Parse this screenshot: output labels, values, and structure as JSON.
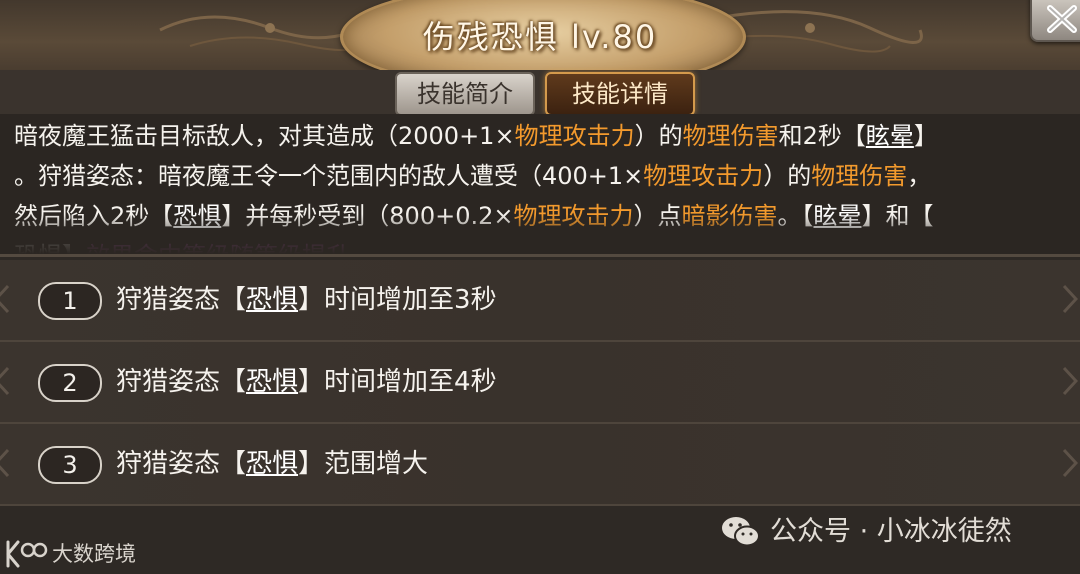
{
  "header": {
    "title": "伤残恐惧 lv.80"
  },
  "tabs": [
    {
      "label": "技能简介",
      "active": false
    },
    {
      "label": "技能详情",
      "active": true
    }
  ],
  "description": {
    "lines": [
      [
        {
          "t": "暗夜魔王猛击目标敌人，对其造成（2000+1×",
          "style": "normal"
        },
        {
          "t": "物理攻击力",
          "style": "orange"
        },
        {
          "t": "）的",
          "style": "normal"
        },
        {
          "t": "物理伤害",
          "style": "orange"
        },
        {
          "t": "和2秒【",
          "style": "normal"
        },
        {
          "t": "眩晕",
          "style": "keyword"
        },
        {
          "t": "】",
          "style": "normal"
        }
      ],
      [
        {
          "t": "。狩猎姿态：暗夜魔王令一个范围内的敌人遭受（400+1×",
          "style": "normal"
        },
        {
          "t": "物理攻击力",
          "style": "orange"
        },
        {
          "t": "）的",
          "style": "normal"
        },
        {
          "t": "物理伤害",
          "style": "orange"
        },
        {
          "t": "，",
          "style": "normal"
        }
      ],
      [
        {
          "t": "然后陷入2秒【",
          "style": "normal"
        },
        {
          "t": "恐惧",
          "style": "keyword"
        },
        {
          "t": "】并每秒受到（800+0.2×",
          "style": "normal"
        },
        {
          "t": "物理攻击力",
          "style": "orange"
        },
        {
          "t": "）点",
          "style": "normal"
        },
        {
          "t": "暗影伤害",
          "style": "orange"
        },
        {
          "t": "。【",
          "style": "normal"
        },
        {
          "t": "眩晕",
          "style": "keyword"
        },
        {
          "t": "】和【",
          "style": "normal"
        }
      ],
      [
        {
          "t": "恐惧】",
          "style": "normal"
        },
        {
          "t": "效果命中等级随等级提升。",
          "style": "purple"
        }
      ]
    ]
  },
  "upgrades": [
    {
      "number": "1",
      "prefix": "狩猎姿态【",
      "keyword": "恐惧",
      "suffix": "】时间增加至3秒"
    },
    {
      "number": "2",
      "prefix": "狩猎姿态【",
      "keyword": "恐惧",
      "suffix": "】时间增加至4秒"
    },
    {
      "number": "3",
      "prefix": "狩猎姿态【",
      "keyword": "恐惧",
      "suffix": "】范围增大"
    }
  ],
  "watermarks": {
    "right": "公众号 · 小冰冰徒然",
    "left": "大数跨境"
  },
  "colors": {
    "highlight_orange": "#f39a2d",
    "highlight_purple": "#c45cc6",
    "panel_bg": "#2e2925"
  },
  "icons": {
    "close": "close-icon",
    "wechat": "wechat-icon",
    "logo": "kr-logo-icon"
  }
}
